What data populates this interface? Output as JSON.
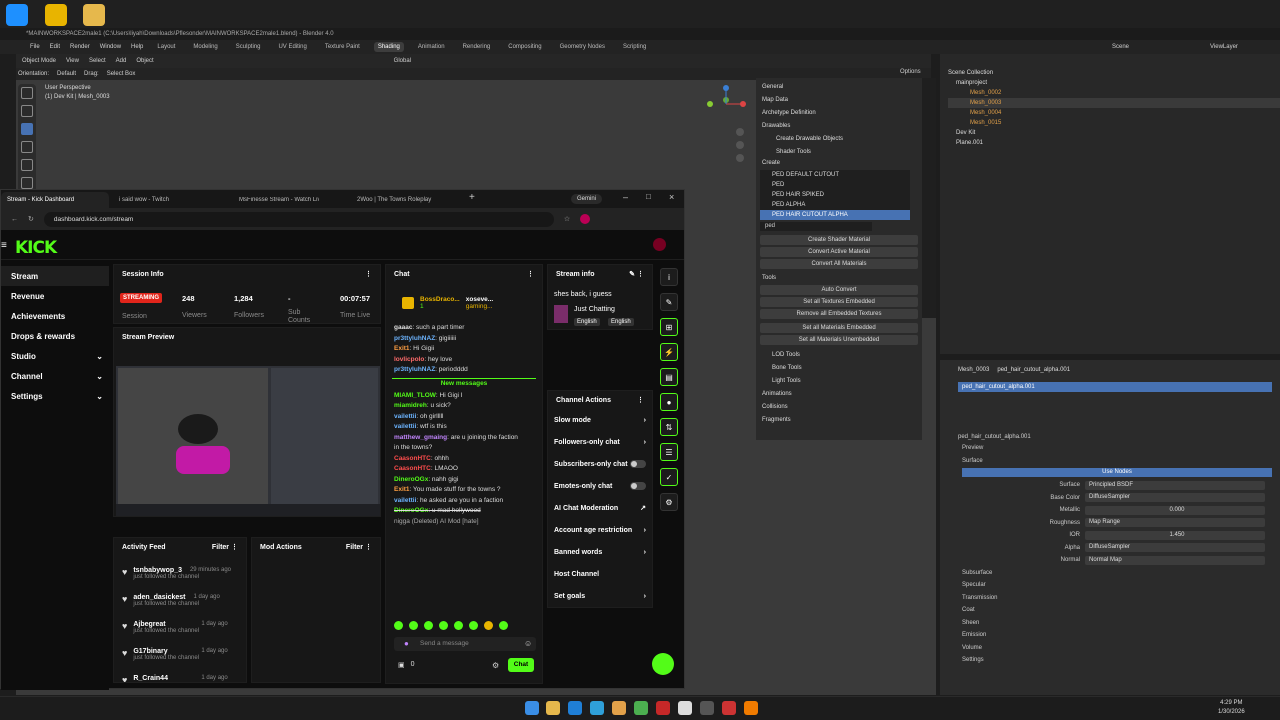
{
  "colors": {
    "kick_green": "#53fc18",
    "blender_blue": "#4772b3",
    "streaming_red": "#e1251b"
  },
  "blender": {
    "title": "*MAINWORKSPACE2male1 (C:\\Users\\liyah\\Downloads\\Pflesonder\\MAINWORKSPACE2male1.blend) - Blender 4.0",
    "menu": [
      "File",
      "Edit",
      "Render",
      "Window",
      "Help"
    ],
    "workspaces": [
      "Layout",
      "Modeling",
      "Sculpting",
      "UV Editing",
      "Texture Paint",
      "Shading",
      "Animation",
      "Rendering",
      "Compositing",
      "Geometry Nodes",
      "Scripting"
    ],
    "active_workspace": "Shading",
    "header": {
      "mode": "Object Mode",
      "view": "View",
      "select": "Select",
      "add": "Add",
      "object": "Object",
      "transform": "Global",
      "options": "Options"
    },
    "subheader": {
      "orientation_label": "Orientation:",
      "orientation": "Default",
      "drag_label": "Drag:",
      "drag": "Select Box"
    },
    "viewport": {
      "line1": "User Perspective",
      "line2": "(1) Dev Kit | Mesh_0003"
    },
    "sollumz": {
      "rows": [
        "General",
        "Map Data",
        "Archetype Definition",
        "Drawables",
        "Create Drawable Objects",
        "Shader Tools"
      ],
      "create_label": "Create",
      "shaders": [
        "PED DEFAULT CUTOUT",
        "PED",
        "PED HAIR SPIKED",
        "PED ALPHA",
        "PED HAIR CUTOUT ALPHA"
      ],
      "search": "ped",
      "buttons": [
        "Create Shader Material",
        "Convert Active Material",
        "Convert All Materials"
      ],
      "tools_label": "Tools",
      "tool_buttons": [
        "Auto Convert",
        "Set all Textures Embedded",
        "Remove all Embedded Textures",
        "Set all Materials Embedded",
        "Set all Materials Unembedded"
      ],
      "lower_rows": [
        "LOD Tools",
        "Bone Tools",
        "Light Tools",
        "Animations",
        "Collisions",
        "Fragments"
      ]
    },
    "outliner": {
      "scene": "Scene",
      "view_layer": "ViewLayer",
      "rows": [
        "Scene Collection",
        "mainproject",
        "Mesh_0002",
        "Mesh_0003",
        "Mesh_0004",
        "Mesh_0015",
        "Dev Kit",
        "Plane.001"
      ]
    },
    "properties": {
      "breadcrumb_obj": "Mesh_0003",
      "breadcrumb_mat": "ped_hair_cutout_alpha.001",
      "slot": "ped_hair_cutout_alpha.001",
      "material": "ped_hair_cutout_alpha.001",
      "preview": "Preview",
      "surface": "Surface",
      "use_nodes": "Use Nodes",
      "fields": [
        {
          "label": "Surface",
          "value": "Principled BSDF"
        },
        {
          "label": "Base Color",
          "value": "DiffuseSampler"
        },
        {
          "label": "Metallic",
          "value": "0.000"
        },
        {
          "label": "Roughness",
          "value": "Map Range"
        },
        {
          "label": "IOR",
          "value": "1.450"
        },
        {
          "label": "Alpha",
          "value": "DiffuseSampler"
        },
        {
          "label": "Normal",
          "value": "Normal Map"
        }
      ],
      "sections": [
        "Subsurface",
        "Specular",
        "Transmission",
        "Coat",
        "Sheen",
        "Emission",
        "Volume",
        "Settings"
      ]
    }
  },
  "browser": {
    "tabs": [
      "Stream - Kick Dashboard",
      "i said wow - Twitch",
      "MsFinesse Stream - Watch Live",
      "2Woo | The Towns Roleplay"
    ],
    "gemini": "Gemini",
    "url": "dashboard.kick.com/stream"
  },
  "kick": {
    "logo": "KICK",
    "nav": [
      "Stream",
      "Revenue",
      "Achievements",
      "Drops & rewards",
      "Studio",
      "Channel",
      "Settings"
    ],
    "session": {
      "title": "Session Info",
      "badge": "STREAMING",
      "session_label": "Session",
      "viewers": "248",
      "viewers_label": "Viewers",
      "followers": "1,284",
      "followers_label": "Followers",
      "subs": "-",
      "subs_label": "Sub Counts",
      "time": "00:07:57",
      "time_label": "Time Live"
    },
    "preview_title": "Stream Preview",
    "chat": {
      "title": "Chat",
      "pinned_user": "BossDraco...",
      "pinned_count": "1",
      "pinned_user2": "xoseve...",
      "pinned_user3": "gaming...",
      "messages": [
        {
          "user": "gaaac",
          "text": ": such a part timer",
          "color": "#e0e0e0"
        },
        {
          "user": "pr3ttyluhNAZ",
          "text": ": gigiiiiii",
          "color": "#6cb4ff"
        },
        {
          "user": "Exit1",
          "text": ": Hi Gigii",
          "color": "#ff9f43"
        },
        {
          "user": "lovlicpolo",
          "text": ": hey love",
          "color": "#ff6b6b"
        },
        {
          "user": "pr3ttyluhNAZ",
          "text": ": periodddd",
          "color": "#6cb4ff"
        }
      ],
      "new_messages": "New messages",
      "messages2": [
        {
          "user": "MIAMI_TLOW",
          "text": ": Hi Gigi I",
          "color": "#53fc18"
        },
        {
          "user": "miamidreh",
          "text": ": u sick?",
          "color": "#53fc18"
        },
        {
          "user": "vailettii",
          "text": ": oh girlllll",
          "color": "#6cb4ff"
        },
        {
          "user": "vailettii",
          "text": ": wtf is this",
          "color": "#6cb4ff"
        },
        {
          "user": "matthew_gmaing",
          "text": ": are u joining the faction",
          "color": "#c084fc"
        },
        {
          "user": "",
          "text": "in the towns?",
          "color": "#ddd"
        },
        {
          "user": "CaasonHTC",
          "text": ": ohhh",
          "color": "#ff4d4d"
        },
        {
          "user": "CaasonHTC",
          "text": ": LMAOO",
          "color": "#ff4d4d"
        },
        {
          "user": "DineroOGx",
          "text": ": nahh gigi",
          "color": "#53fc18"
        },
        {
          "user": "Exit1",
          "text": ": You made stuff for the towns ?",
          "color": "#ff9f43"
        },
        {
          "user": "vailettii",
          "text": ": he asked are you in a faction",
          "color": "#6cb4ff"
        },
        {
          "user": "DineroOGx",
          "text": ": u mad hollywood",
          "color": "#53fc18"
        },
        {
          "user": "",
          "text": "nigga (Deleted) AI Mod [hate]",
          "color": "#aaa"
        }
      ],
      "placeholder": "Send a message",
      "points": "0",
      "send": "Chat"
    },
    "stream_info": {
      "title": "Stream info",
      "stream_title": "shes back, i guess",
      "category": "Just Chatting",
      "tag1": "English",
      "tag2": "English"
    },
    "channel_actions": {
      "title": "Channel Actions",
      "items": [
        "Slow mode",
        "Followers-only chat",
        "Subscribers-only chat",
        "Emotes-only chat",
        "AI Chat Moderation",
        "Account age restriction",
        "Banned words",
        "Host Channel",
        "Set goals"
      ]
    },
    "activity": {
      "title": "Activity Feed",
      "filter": "Filter",
      "items": [
        {
          "user": "tsnbabywop_3",
          "time": "29 minutes ago",
          "text": "just followed the channel"
        },
        {
          "user": "aden_dasickest",
          "time": "1 day ago",
          "text": "just followed the channel"
        },
        {
          "user": "Ajbegreat",
          "time": "1 day ago",
          "text": "just followed the channel"
        },
        {
          "user": "G17binary",
          "time": "1 day ago",
          "text": "just followed the channel"
        },
        {
          "user": "R_Crain44",
          "time": "1 day ago",
          "text": ""
        }
      ]
    },
    "mod_actions": {
      "title": "Mod Actions",
      "filter": "Filter"
    }
  },
  "taskbar": {
    "time": "4:29 PM",
    "date": "1/30/2026"
  }
}
